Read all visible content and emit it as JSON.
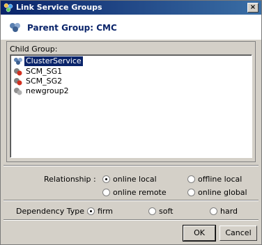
{
  "window": {
    "title": "Link Service Groups",
    "close_label": "×"
  },
  "header": {
    "parent_group": "Parent Group: CMC"
  },
  "child_group": {
    "label": "Child Group:",
    "items": [
      {
        "label": "ClusterService",
        "icon": "cluster-group-icon",
        "selected": true
      },
      {
        "label": "SCM_SG1",
        "icon": "service-group-faulted-icon",
        "selected": false
      },
      {
        "label": "SCM_SG2",
        "icon": "service-group-faulted-icon",
        "selected": false
      },
      {
        "label": "newgroup2",
        "icon": "service-group-offline-icon",
        "selected": false
      }
    ]
  },
  "relationship": {
    "label": "Relationship :",
    "options": [
      {
        "label": "online local",
        "checked": true
      },
      {
        "label": "offline local",
        "checked": false
      },
      {
        "label": "online remote",
        "checked": false
      },
      {
        "label": "online global",
        "checked": false
      }
    ]
  },
  "dependency": {
    "label": "Dependency Type :",
    "options": [
      {
        "label": "firm",
        "checked": true
      },
      {
        "label": "soft",
        "checked": false
      },
      {
        "label": "hard",
        "checked": false
      }
    ]
  },
  "buttons": {
    "ok": "OK",
    "cancel": "Cancel"
  },
  "colors": {
    "titlebar": "#0a246a",
    "selection": "#0a246a",
    "face": "#d4d0c8"
  }
}
